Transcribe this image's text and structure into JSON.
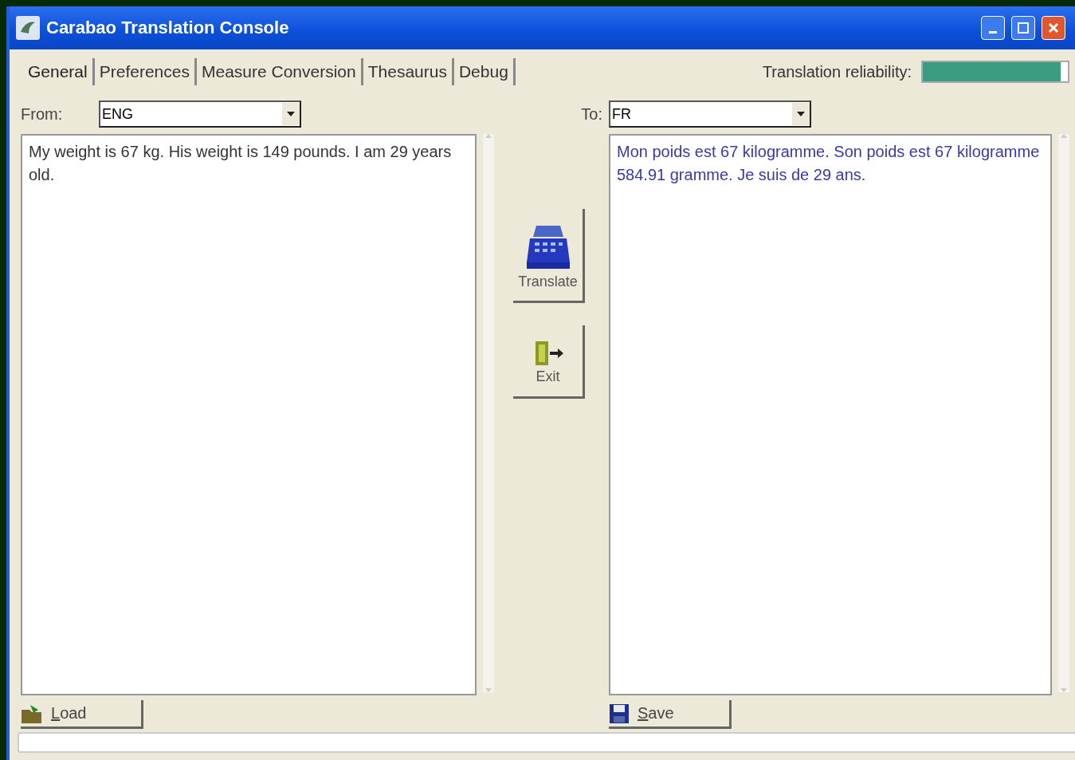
{
  "window": {
    "title": "Carabao Translation Console"
  },
  "tabs": [
    {
      "label": "General",
      "selected": true
    },
    {
      "label": "Preferences",
      "selected": false
    },
    {
      "label": "Measure Conversion",
      "selected": false
    },
    {
      "label": "Thesaurus",
      "selected": false
    },
    {
      "label": "Debug",
      "selected": false
    }
  ],
  "reliability": {
    "label": "Translation reliability:",
    "level": 0.95
  },
  "from": {
    "label": "From:",
    "value": "ENG"
  },
  "to": {
    "label": "To:",
    "value": "FR"
  },
  "source_text": "My weight is 67 kg. His weight is 149 pounds. I am 29 years old.",
  "target_text": "Mon poids est 67 kilogramme. Son poids est 67 kilogramme 584.91 gramme. Je suis de 29 ans.",
  "actions": [
    {
      "kind": "translate",
      "label": "Translate"
    },
    {
      "kind": "exit",
      "label": "Exit"
    }
  ],
  "load_button": "Load",
  "save_button": "Save"
}
